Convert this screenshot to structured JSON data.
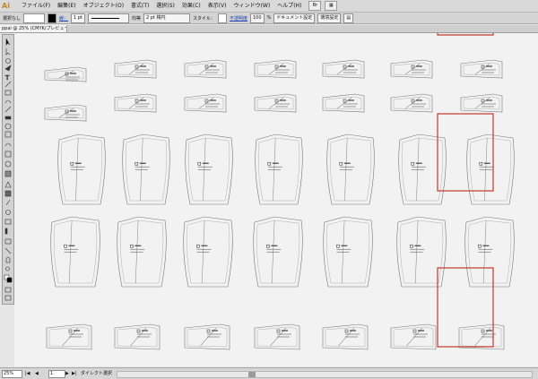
{
  "app": {
    "logo": "Ai",
    "brand_color": "#c08a2a"
  },
  "menu": {
    "items": [
      "ファイル(F)",
      "編集(E)",
      "オブジェクト(O)",
      "書式(T)",
      "選択(S)",
      "効果(C)",
      "表示(V)",
      "ウィンドウ(W)",
      "ヘルプ(H)"
    ]
  },
  "control_bar": {
    "selection": "選択なし",
    "stroke_label": "線：",
    "stroke_weight": "1 pt",
    "profile": "均等",
    "brush": "2 pt 楕円",
    "style_label": "スタイル：",
    "opacity_label": "不透明度",
    "opacity": "100",
    "percent": "%",
    "doc_settings": "ドキュメント設定",
    "prefs": "環境設定"
  },
  "tab": {
    "title": "ppai @ 25% (CMYK/プレビュー)"
  },
  "status": {
    "zoom": "25%",
    "page": "1",
    "tool": "ダイレクト選択"
  },
  "canvas": {
    "highlight_color": "#c0392b",
    "pattern_stroke": "#777777"
  }
}
